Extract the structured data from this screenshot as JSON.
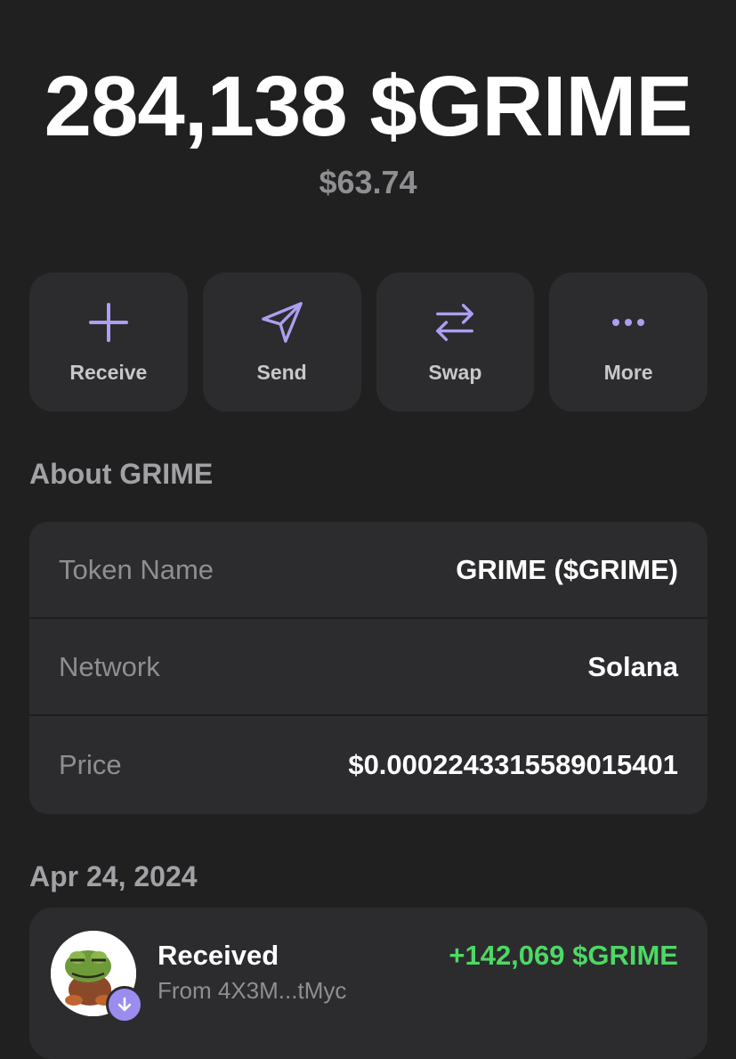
{
  "balance": {
    "amount": "284,138 $GRIME",
    "usd_value": "$63.74"
  },
  "actions": [
    {
      "label": "Receive",
      "icon": "plus-icon"
    },
    {
      "label": "Send",
      "icon": "send-icon"
    },
    {
      "label": "Swap",
      "icon": "swap-icon"
    },
    {
      "label": "More",
      "icon": "more-icon"
    }
  ],
  "about": {
    "title": "About GRIME",
    "rows": [
      {
        "key": "Token Name",
        "value": "GRIME ($GRIME)"
      },
      {
        "key": "Network",
        "value": "Solana"
      },
      {
        "key": "Price",
        "value": "$0.0002243315589015401"
      }
    ]
  },
  "activity": {
    "date": "Apr 24, 2024",
    "items": [
      {
        "title": "Received",
        "subtitle": "From 4X3M...tMyc",
        "amount": "+142,069 $GRIME",
        "avatar": "frog-avatar",
        "badge_icon": "arrow-down-icon"
      }
    ]
  },
  "colors": {
    "background": "#202020",
    "card": "#2c2c2e",
    "accent": "#ab9ff2",
    "positive": "#4cd964",
    "muted": "#8e8e93"
  }
}
